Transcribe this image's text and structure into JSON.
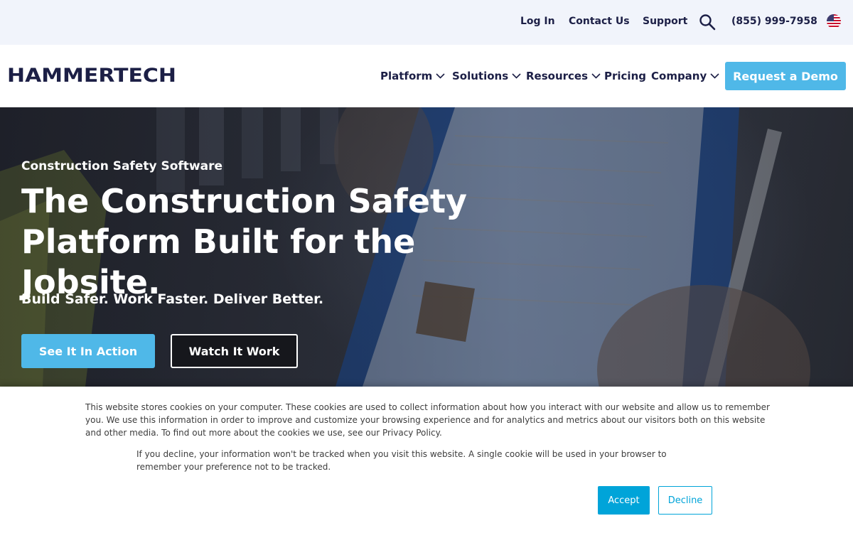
{
  "utility_bar": {
    "login": "Log In",
    "contact": "Contact Us",
    "support": "Support",
    "phone": "(855) 999-7958",
    "search_icon": "search-icon",
    "flag_icon": "us-flag-icon"
  },
  "nav": {
    "logo_text": "HAMMERTECH",
    "items": [
      {
        "label": "Platform",
        "has_dropdown": true
      },
      {
        "label": "Solutions",
        "has_dropdown": true
      },
      {
        "label": "Resources",
        "has_dropdown": true
      },
      {
        "label": "Pricing",
        "has_dropdown": false
      },
      {
        "label": "Company",
        "has_dropdown": true
      }
    ],
    "cta": "Request a Demo"
  },
  "hero": {
    "eyebrow": "Construction Safety Software",
    "title": "The Construction Safety Platform Built for the Jobsite.",
    "subtitle": "Build Safer. Work Faster. Deliver Better.",
    "primary_button": "See It In Action",
    "secondary_button": "Watch It Work"
  },
  "cookie_banner": {
    "text_main": "This website stores cookies on your computer. These cookies are used to collect information about how you interact with our website and allow us to remember you. We use this information in order to improve and customize your browsing experience and for analytics and metrics about our visitors both on this website and other media. To find out more about the cookies we use, see our Privacy Policy.",
    "text_decline": "If you decline, your information won't be tracked when you visit this website. A single cookie will be used in your browser to remember your preference not to be tracked.",
    "accept": "Accept",
    "decline": "Decline"
  },
  "colors": {
    "brand_navy": "#1c1f46",
    "accent_blue": "#4fb8e8",
    "cookie_accent": "#00a4d9",
    "utility_bg": "#f1f4fb"
  }
}
